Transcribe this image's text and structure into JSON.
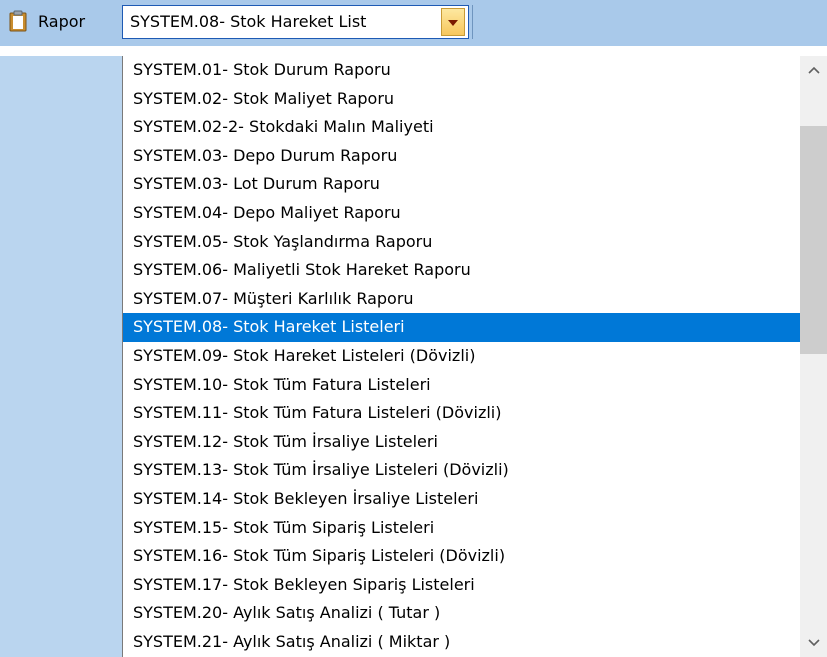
{
  "toolbar": {
    "label": "Rapor",
    "icon": "clipboard-icon",
    "combo_value": "SYSTEM.08- Stok Hareket List",
    "combo_button_icon": "chevron-down-icon"
  },
  "dropdown": {
    "items": [
      "SYSTEM.01- Stok Durum Raporu",
      "SYSTEM.02- Stok Maliyet Raporu",
      "SYSTEM.02-2- Stokdaki Malın Maliyeti",
      "SYSTEM.03- Depo Durum Raporu",
      "SYSTEM.03- Lot Durum Raporu",
      "SYSTEM.04- Depo Maliyet Raporu",
      "SYSTEM.05- Stok Yaşlandırma Raporu",
      "SYSTEM.06- Maliyetli Stok Hareket Raporu",
      "SYSTEM.07- Müşteri Karlılık Raporu",
      "SYSTEM.08- Stok Hareket Listeleri",
      "SYSTEM.09- Stok Hareket Listeleri (Dövizli)",
      "SYSTEM.10- Stok Tüm Fatura Listeleri",
      "SYSTEM.11- Stok Tüm Fatura Listeleri (Dövizli)",
      "SYSTEM.12- Stok Tüm İrsaliye Listeleri",
      "SYSTEM.13- Stok Tüm İrsaliye Listeleri (Dövizli)",
      "SYSTEM.14- Stok Bekleyen İrsaliye Listeleri",
      "SYSTEM.15- Stok Tüm Sipariş Listeleri",
      "SYSTEM.16- Stok Tüm Sipariş Listeleri (Dövizli)",
      "SYSTEM.17- Stok Bekleyen Sipariş Listeleri",
      "SYSTEM.20- Aylık Satış Analizi ( Tutar )",
      "SYSTEM.21- Aylık Satış Analizi ( Miktar )"
    ],
    "selected_index": 9
  },
  "scrollbar": {
    "up_icon": "chevron-up-icon",
    "down_icon": "chevron-down-icon"
  },
  "colors": {
    "toolbar_bg": "#a9c9ea",
    "left_pane_bg": "#bad5ef",
    "selection": "#0078d7",
    "combo_border": "#1e5ab4"
  }
}
